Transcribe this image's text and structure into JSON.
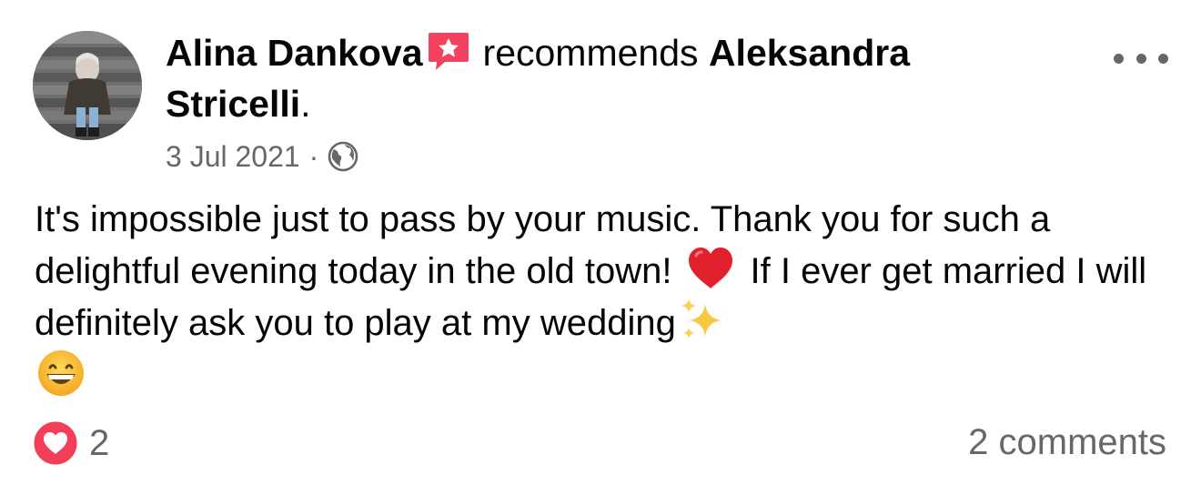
{
  "post": {
    "author": "Alina Dankova",
    "action": "recommends",
    "page_name": "Aleksandra Stricelli",
    "page_suffix": ".",
    "date": "3 Jul 2021",
    "separator": "·",
    "privacy_icon": "globe-icon",
    "text_parts": [
      "It's impossible just to pass by your music. Thank you for such a delightful evening today in the old town!",
      "If I ever get married I will definitely ask you to play at my wedding"
    ],
    "emojis": [
      "red-heart",
      "sparkles",
      "grinning-face"
    ]
  },
  "footer": {
    "reaction_icon": "love-reaction-icon",
    "reaction_count": "2",
    "comments_label": "2 comments"
  },
  "colors": {
    "text": "#050505",
    "secondary": "#65676b",
    "recommend_badge": "#f3425f",
    "love_reaction": "#f33e58"
  }
}
